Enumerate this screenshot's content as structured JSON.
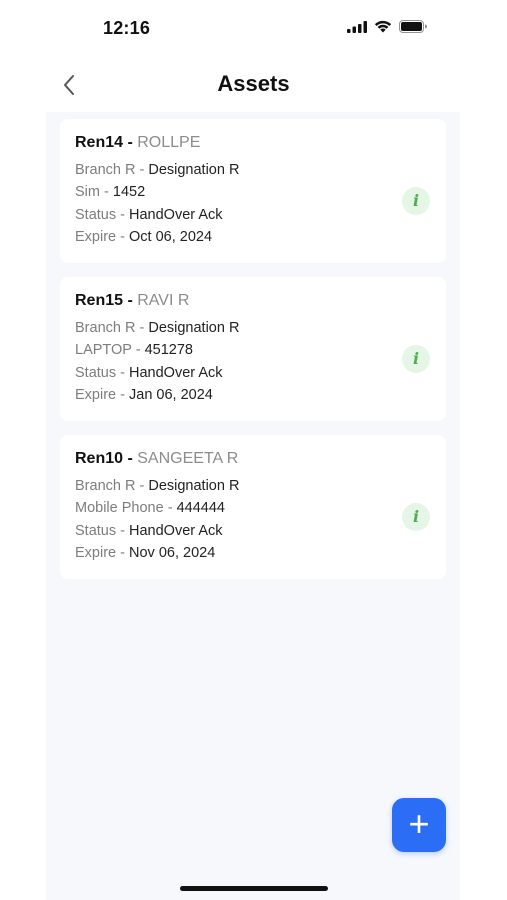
{
  "status_bar": {
    "time": "12:16"
  },
  "header": {
    "title": "Assets",
    "back_icon": "chevron-left-icon"
  },
  "assets": [
    {
      "code": "Ren14 -",
      "name": "ROLLPE",
      "rows": [
        {
          "k": "Branch R -",
          "v": "Designation R"
        },
        {
          "k": "Sim -",
          "v": "1452"
        },
        {
          "k": "Status -",
          "v": "HandOver Ack"
        },
        {
          "k": "Expire -",
          "v": "Oct 06, 2024"
        }
      ],
      "info_icon": "i"
    },
    {
      "code": "Ren15 -",
      "name": "RAVI R",
      "rows": [
        {
          "k": "Branch R -",
          "v": "Designation R"
        },
        {
          "k": "LAPTOP -",
          "v": "451278"
        },
        {
          "k": "Status -",
          "v": "HandOver Ack"
        },
        {
          "k": "Expire -",
          "v": "Jan 06, 2024"
        }
      ],
      "info_icon": "i"
    },
    {
      "code": "Ren10 -",
      "name": "SANGEETA R",
      "rows": [
        {
          "k": "Branch R -",
          "v": "Designation R"
        },
        {
          "k": "Mobile Phone -",
          "v": "444444"
        },
        {
          "k": "Status -",
          "v": "HandOver Ack"
        },
        {
          "k": "Expire -",
          "v": "Nov 06, 2024"
        }
      ],
      "info_icon": "i"
    }
  ],
  "fab": {
    "label": "+",
    "icon": "plus-icon"
  },
  "colors": {
    "accent": "#2b6df4",
    "info_bg": "#e5f5e6",
    "info_fg": "#4caf50",
    "list_bg": "#f7f8fc"
  }
}
